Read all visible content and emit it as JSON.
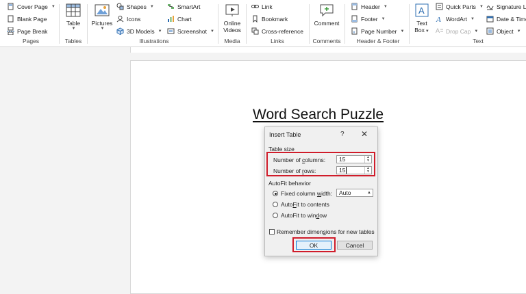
{
  "ribbon": {
    "pages": {
      "group_label": "Pages",
      "cover_page": "Cover Page",
      "blank_page": "Blank Page",
      "page_break": "Page Break"
    },
    "tables": {
      "group_label": "Tables",
      "table": "Table"
    },
    "illustrations": {
      "group_label": "Illustrations",
      "pictures": "Pictures",
      "shapes": "Shapes",
      "icons": "Icons",
      "models_3d": "3D Models",
      "smartart": "SmartArt",
      "chart": "Chart",
      "screenshot": "Screenshot"
    },
    "media": {
      "group_label": "Media",
      "online_videos_line1": "Online",
      "online_videos_line2": "Videos"
    },
    "links": {
      "group_label": "Links",
      "link": "Link",
      "bookmark": "Bookmark",
      "cross_reference": "Cross-reference"
    },
    "comments": {
      "group_label": "Comments",
      "comment": "Comment"
    },
    "header_footer": {
      "group_label": "Header & Footer",
      "header": "Header",
      "footer": "Footer",
      "page_number": "Page Number"
    },
    "text": {
      "group_label": "Text",
      "text_box_line1": "Text",
      "text_box_line2": "Box",
      "quick_parts": "Quick Parts",
      "wordart": "WordArt",
      "drop_cap": "Drop Cap",
      "signature_line": "Signature Li",
      "date_time": "Date & Time",
      "object": "Object"
    }
  },
  "document": {
    "title": "Word Search Puzzle"
  },
  "dialog": {
    "title": "Insert Table",
    "help": "?",
    "close": "✕",
    "table_size_label": "Table size",
    "columns_label_pre": "Number of ",
    "columns_label_acc": "c",
    "columns_label_post": "olumns:",
    "columns_value": "15",
    "rows_label_pre": "Number of ",
    "rows_label_acc": "r",
    "rows_label_post": "ows:",
    "rows_value": "15",
    "autofit_label": "AutoFit behavior",
    "fixed_pre": "Fixed column ",
    "fixed_acc": "w",
    "fixed_post": "idth:",
    "fixed_value": "Auto",
    "autofit_contents_pre": "Auto",
    "autofit_contents_acc": "F",
    "autofit_contents_post": "it to contents",
    "autofit_window_pre": "AutoFit to win",
    "autofit_window_acc": "d",
    "autofit_window_post": "ow",
    "remember_label": "Remember dimen",
    "remember_acc": "s",
    "remember_post": "ions for new tables",
    "ok": "OK",
    "cancel": "Cancel"
  },
  "colors": {
    "highlight": "#d01c2a",
    "accent": "#0078d7"
  }
}
